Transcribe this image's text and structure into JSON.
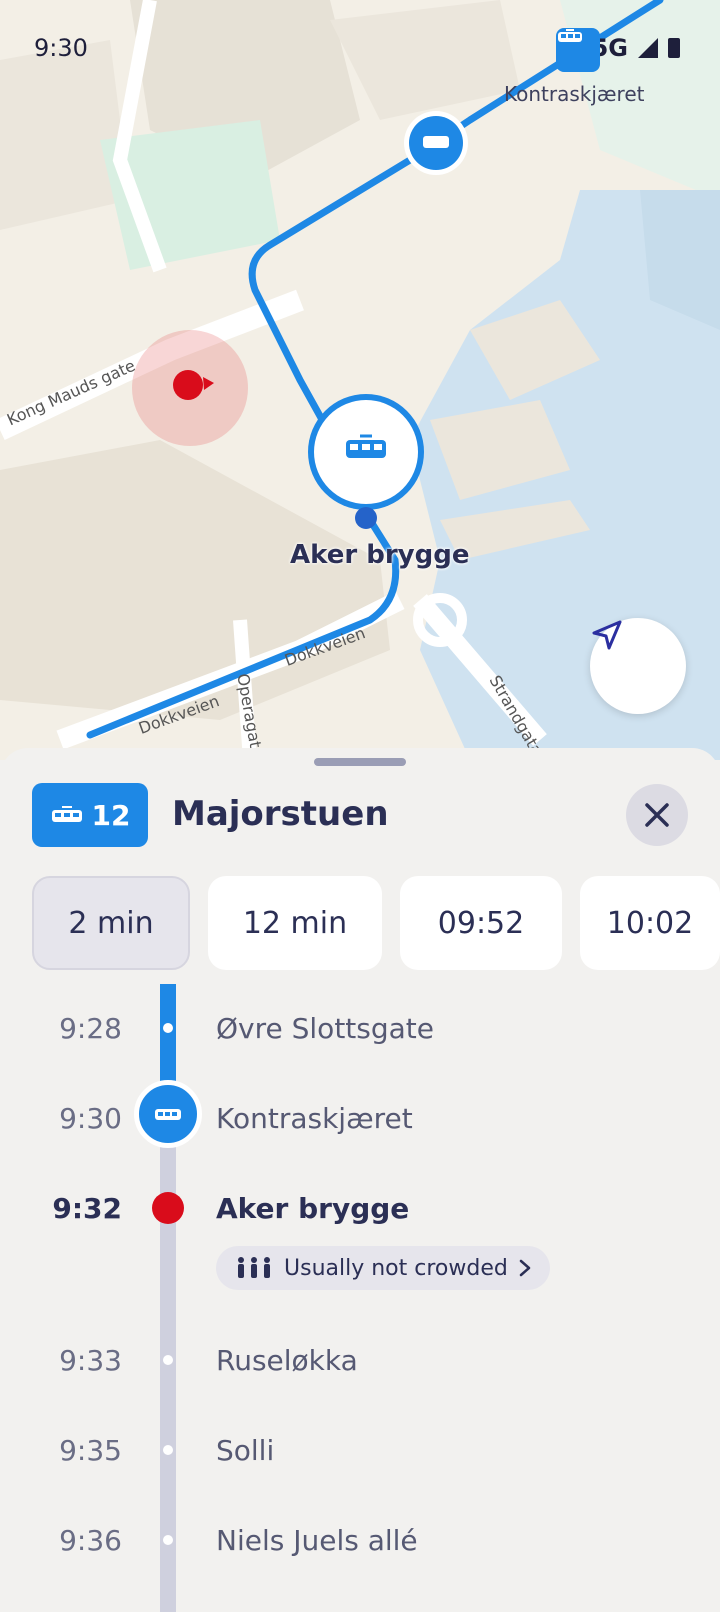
{
  "status_bar": {
    "time": "9:30",
    "network": "5G"
  },
  "map": {
    "vehicle_stop_label": "Kontraskjæret",
    "current_stop_label": "Aker brygge",
    "streets": [
      "Kong Mauds gate",
      "Dokkveien",
      "Dokkveien",
      "Operagata",
      "Strandgata"
    ]
  },
  "sheet": {
    "line_number": "12",
    "destination": "Majorstuen",
    "departures": [
      "2 min",
      "12 min",
      "09:52",
      "10:02"
    ],
    "stops": [
      {
        "time": "9:28",
        "name": "Øvre Slottsgate",
        "state": "passed"
      },
      {
        "time": "9:30",
        "name": "Kontraskjæret",
        "state": "vehicle"
      },
      {
        "time": "9:32",
        "name": "Aker brygge",
        "state": "current"
      },
      {
        "time": "9:33",
        "name": "Ruseløkka",
        "state": "upcoming"
      },
      {
        "time": "9:35",
        "name": "Solli",
        "state": "upcoming"
      },
      {
        "time": "9:36",
        "name": "Niels Juels allé",
        "state": "upcoming"
      }
    ],
    "crowding": "Usually not crowded"
  },
  "colors": {
    "accent": "#1e88e5",
    "current_stop": "#d90c1b",
    "text": "#2b2f55"
  },
  "icons": [
    "tram-icon",
    "location-arrow-icon",
    "close-icon",
    "people-icon",
    "chevron-right-icon"
  ]
}
